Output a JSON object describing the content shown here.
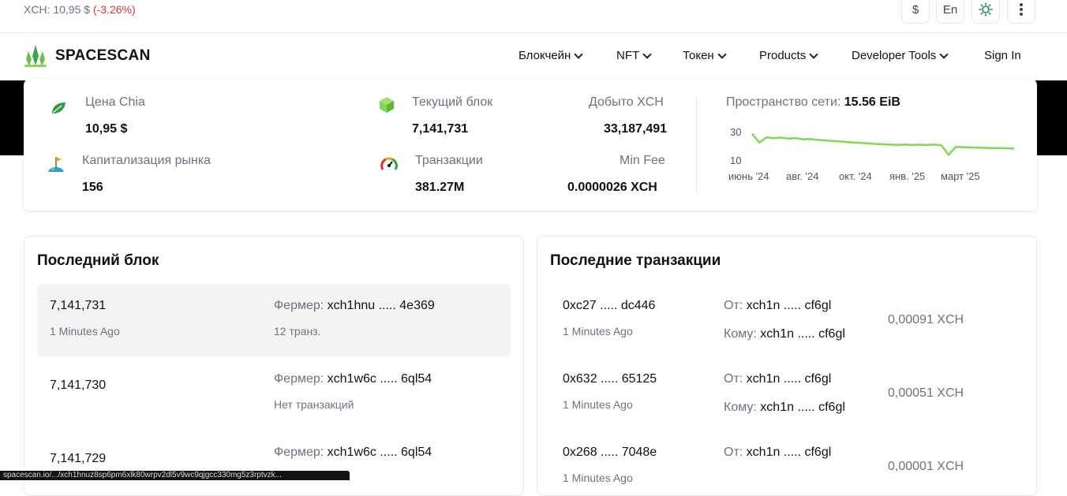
{
  "ticker": {
    "symbol": "XCH:",
    "price": "10,95 $",
    "change": "(-3.26%)"
  },
  "topbar": {
    "currency_btn": "$",
    "lang_btn": "En"
  },
  "nav": {
    "brand": "SPACESCAN",
    "items": [
      {
        "label": "Блокчейн"
      },
      {
        "label": "NFT"
      },
      {
        "label": "Токен"
      },
      {
        "label": "Products"
      },
      {
        "label": "Developer Tools"
      }
    ],
    "sign_in": "Sign In"
  },
  "stats": {
    "price_label": "Цена Chia",
    "price_value": "10,95 $",
    "cap_label": "Капитализация рынка",
    "cap_value": "156",
    "block_label": "Текущий блок",
    "block_value": "7,141,731",
    "mined_label": "Добыто XCH",
    "mined_value": "33,187,491",
    "tx_label": "Транзакции",
    "tx_value": "381.27M",
    "fee_label": "Min Fee",
    "fee_value": "0.0000026 XCH",
    "space_label": "Пространство сети:",
    "space_value": "15.56 EiB"
  },
  "chart_data": {
    "type": "line",
    "title": "",
    "xlabel": "",
    "ylabel": "",
    "y_ticks": [
      "30",
      "10"
    ],
    "x_ticks": [
      "июнь '24",
      "авг. '24",
      "окт. '24",
      "янв. '25",
      "март '25"
    ],
    "ylim": [
      8,
      34
    ],
    "series": [
      {
        "values": [
          27,
          22,
          25,
          24.5,
          24.8,
          24.2,
          24.6,
          23.8,
          24,
          23.5,
          23.2,
          22.9,
          22.6,
          22.3,
          22,
          21.8,
          21.5,
          21.2,
          21,
          20.8,
          20.7,
          20.9,
          20.6,
          20.8,
          20.6,
          20.9,
          20.4,
          15,
          19.5,
          19.4,
          19.2,
          19.1,
          19,
          18.8,
          18.9,
          18.7,
          18.6
        ]
      }
    ],
    "color": "#7ed957",
    "grid": false
  },
  "latest_blocks": {
    "title": "Последний блок",
    "farmer_label": "Фермер:",
    "rows": [
      {
        "height": "7,141,731",
        "time": "1 Minutes Ago",
        "farmer": "xch1hnu ..... 4e369",
        "tx": "12 транз."
      },
      {
        "height": "7,141,730",
        "time": "",
        "farmer": "xch1w6c ..... 6ql54",
        "tx": "Нет транзакций"
      },
      {
        "height": "7,141,729",
        "time": "",
        "farmer": "xch1w6c ..... 6ql54",
        "tx": ""
      }
    ]
  },
  "latest_tx": {
    "title": "Последние транзакции",
    "from_label": "От:",
    "to_label": "Кому:",
    "rows": [
      {
        "hash": "0xc27 ..... dc446",
        "time": "1 Minutes Ago",
        "from": "xch1n ..... cf6gl",
        "to": "xch1n ..... cf6gl",
        "amount": "0,00091 XCH"
      },
      {
        "hash": "0x632 ..... 65125",
        "time": "1 Minutes Ago",
        "from": "xch1n ..... cf6gl",
        "to": "xch1n ..... cf6gl",
        "amount": "0,00051 XCH"
      },
      {
        "hash": "0x268 ..... 7048e",
        "time": "1 Minutes Ago",
        "from": "xch1n ..... cf6gl",
        "to": "",
        "amount": "0,00001 XCH"
      }
    ]
  },
  "statusbar": "spacescan.io/.../xch1hnuz8sp6pm6xlk80wrpv2dl5v9wc9qjgcc330mg5z3rptvzk..."
}
